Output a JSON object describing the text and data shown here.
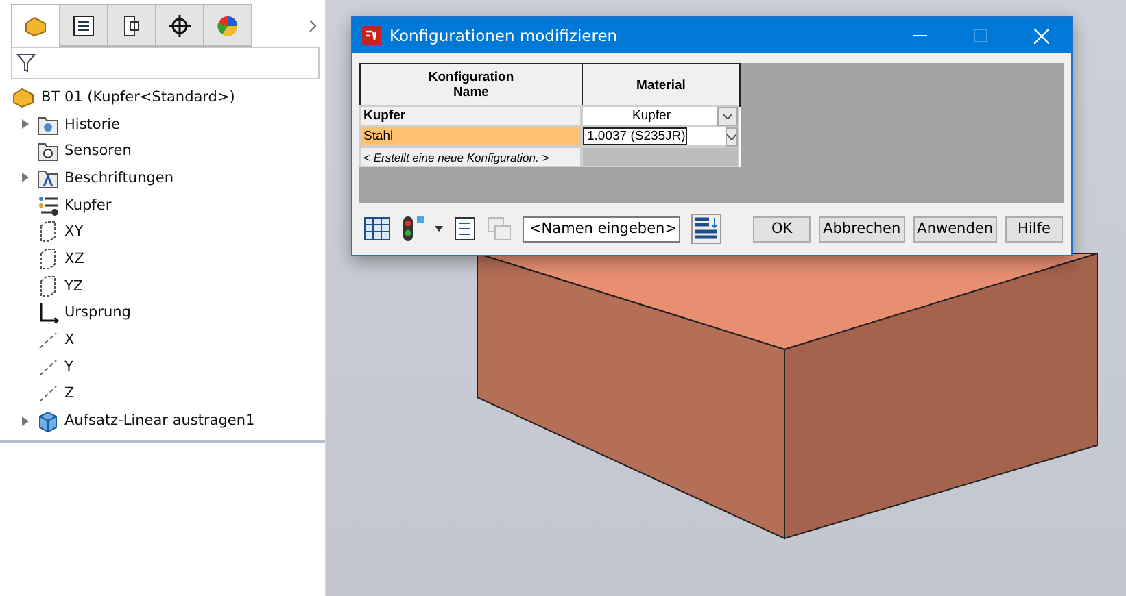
{
  "panel_tabs": [
    {
      "kind": "feature-tree",
      "selected": true
    },
    {
      "kind": "property",
      "selected": false
    },
    {
      "kind": "configuration",
      "selected": false
    },
    {
      "kind": "dimxpert",
      "selected": false
    },
    {
      "kind": "display",
      "selected": false
    }
  ],
  "tree": {
    "root": "BT 01  (Kupfer<Standard>)",
    "items": [
      {
        "label": "Historie",
        "kind": "history",
        "expanded": false
      },
      {
        "label": "Sensoren",
        "kind": "sensor"
      },
      {
        "label": "Beschriftungen",
        "kind": "annotation",
        "expanded": false
      },
      {
        "label": "Kupfer",
        "kind": "material"
      },
      {
        "label": "XY",
        "kind": "plane"
      },
      {
        "label": "XZ",
        "kind": "plane"
      },
      {
        "label": "YZ",
        "kind": "plane"
      },
      {
        "label": "Ursprung",
        "kind": "origin"
      },
      {
        "label": "X",
        "kind": "axis"
      },
      {
        "label": "Y",
        "kind": "axis"
      },
      {
        "label": "Z",
        "kind": "axis"
      },
      {
        "label": "Aufsatz-Linear austragen1",
        "kind": "extrude",
        "expanded": false
      }
    ]
  },
  "dialog": {
    "title": "Konfigurationen modifizieren",
    "columns": [
      "Konfiguration\nName",
      "Material"
    ],
    "rows": [
      {
        "kind": "config",
        "name": "Kupfer",
        "material": "Kupfer",
        "active": true,
        "selected": false
      },
      {
        "kind": "config",
        "name": "Stahl",
        "material": "1.0037 (S235JR)",
        "active": false,
        "selected": true
      },
      {
        "kind": "new",
        "name": "< Erstellt eine neue Konfiguration. >",
        "active": false,
        "selected": false
      }
    ],
    "name_combo": "<Namen eingeben>",
    "buttons": [
      "OK",
      "Abbrechen",
      "Anwenden",
      "Hilfe"
    ]
  }
}
